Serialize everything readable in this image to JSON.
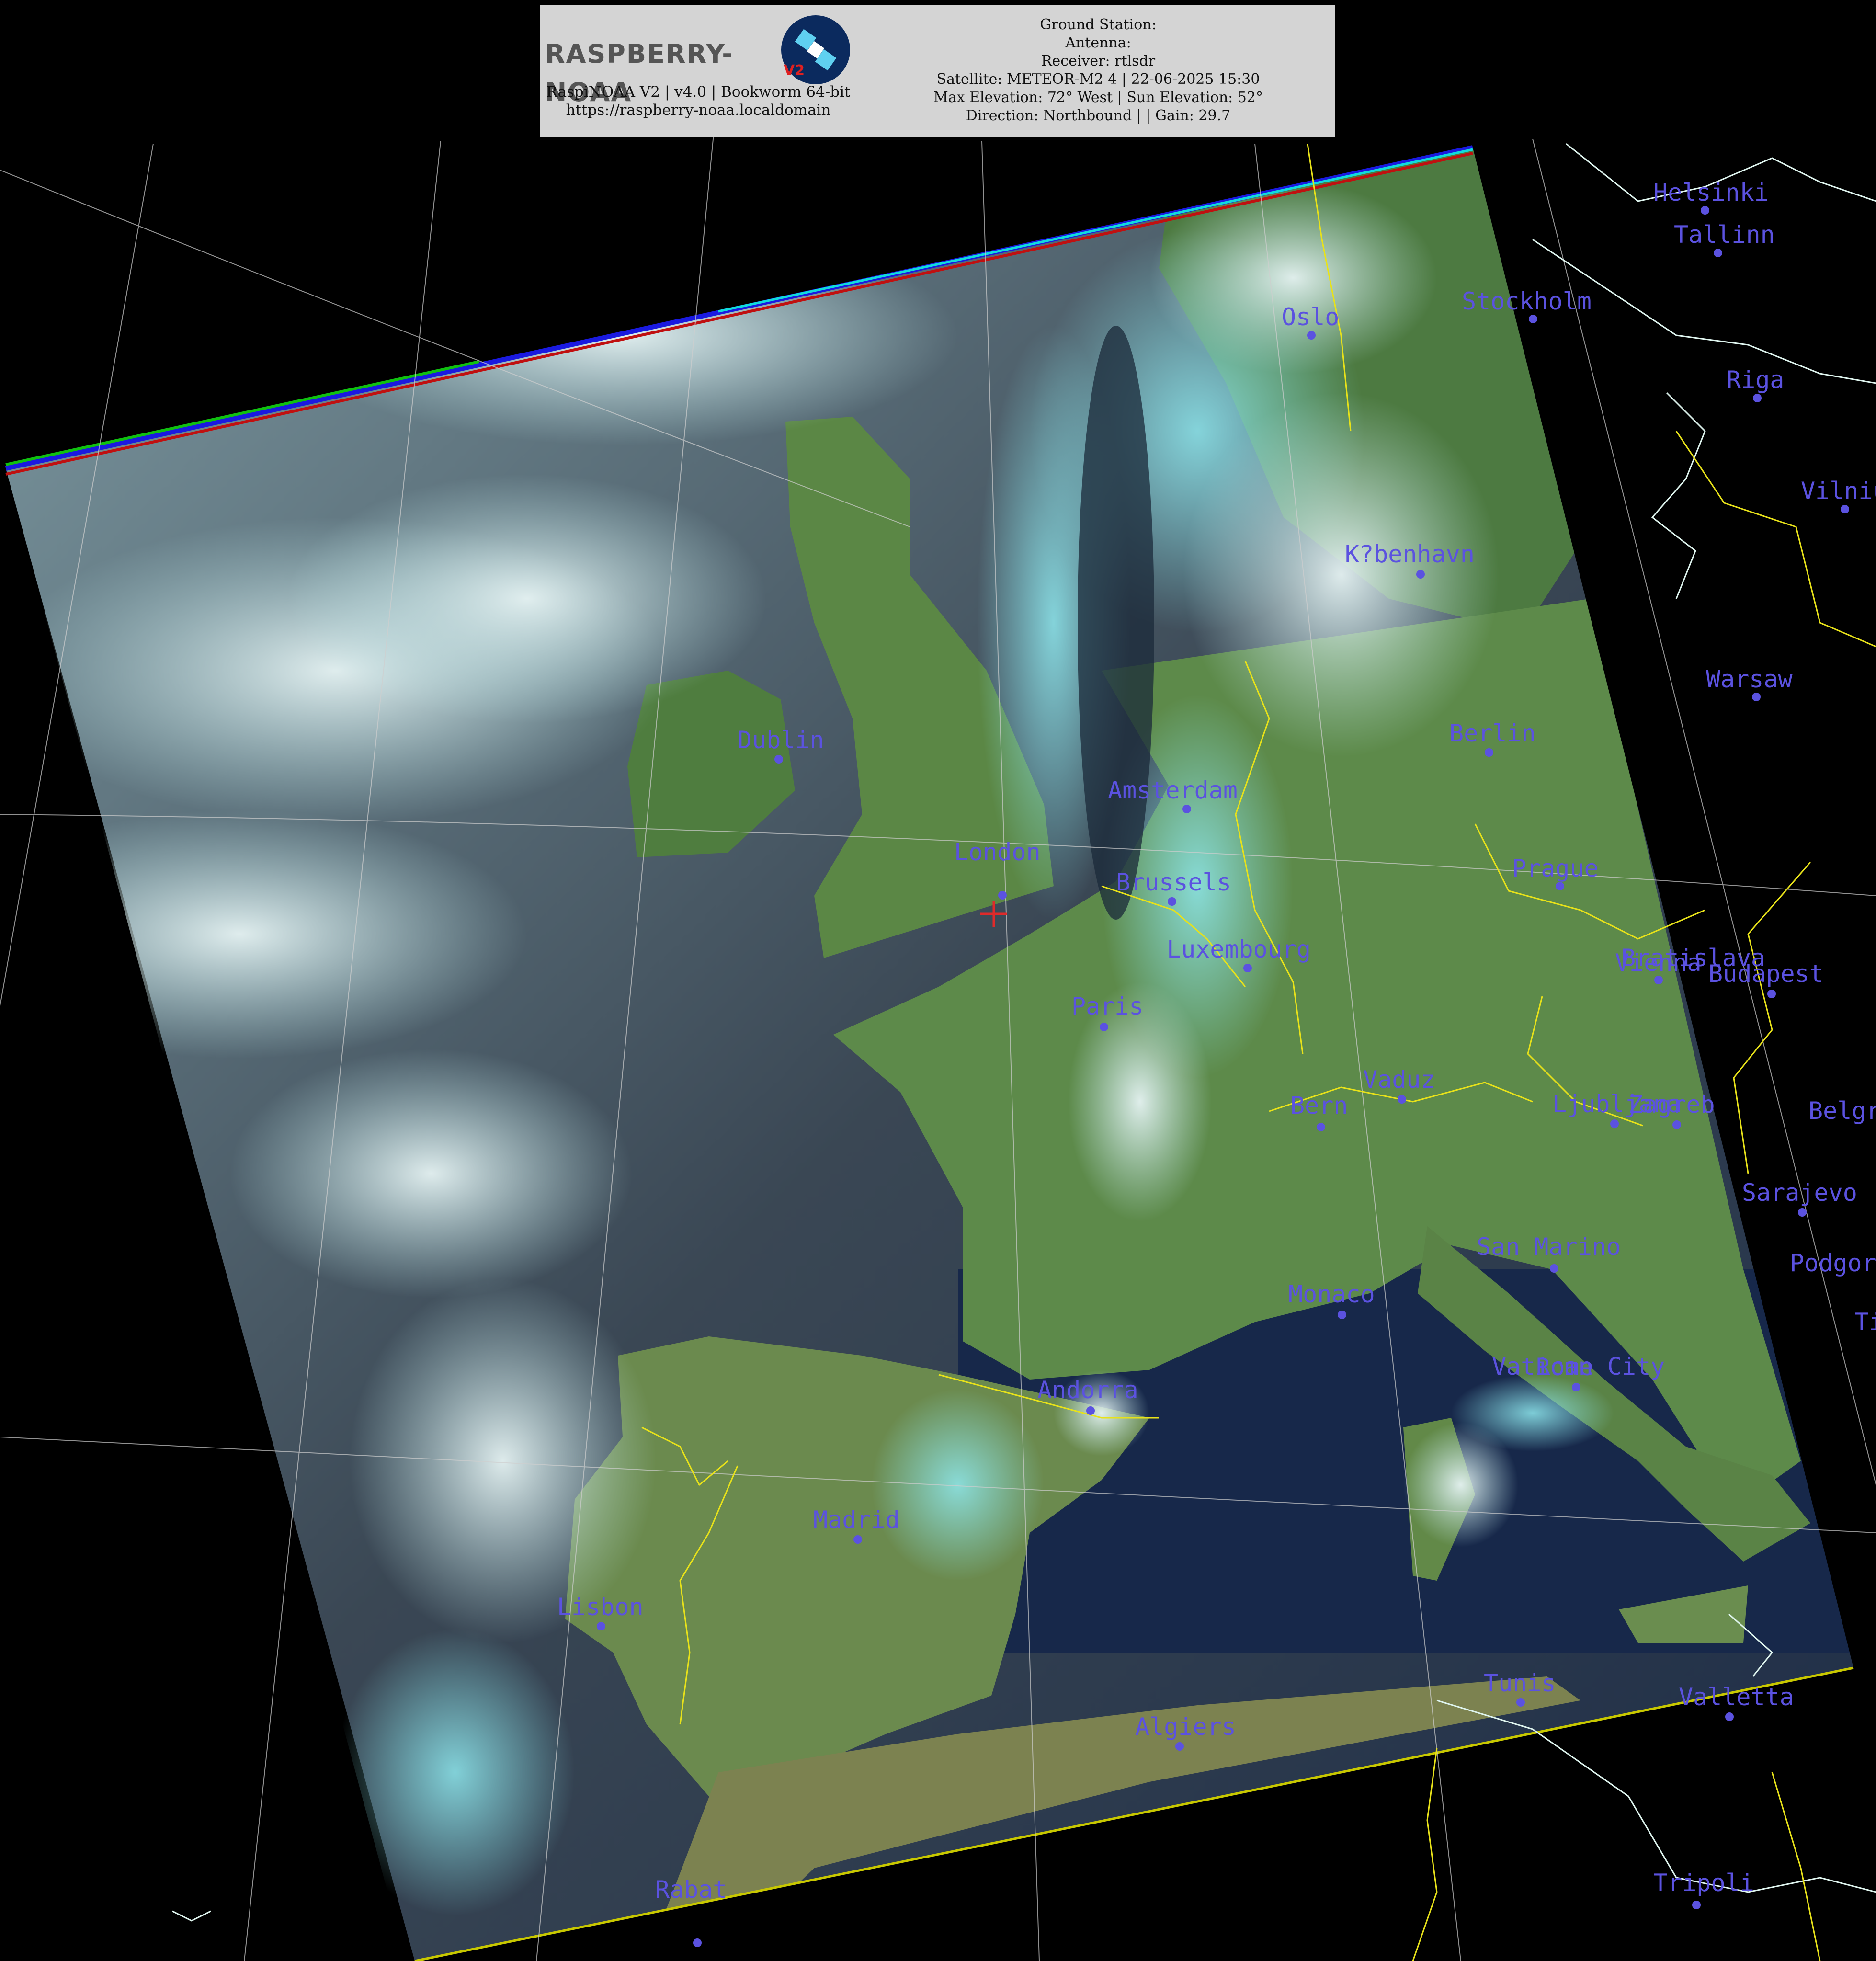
{
  "header": {
    "logo_text": "RASPBERRY-NOAA",
    "logo_badge": "V2",
    "software": "RaspiNOAA V2 | v4.0 | Bookworm 64-bit",
    "url": "https://raspberry-noaa.localdomain",
    "ground_station": "Ground Station:",
    "antenna": "Antenna:",
    "receiver": "Receiver: rtlsdr",
    "satellite_line": "Satellite: METEOR-M2 4 | 22-06-2025 15:30",
    "elevation_line": "Max Elevation: 72° West | Sun Elevation: 52°",
    "direction_line": "Direction: Northbound | | Gain: 29.7"
  },
  "colors": {
    "city_label": "#5b52e0",
    "graticule": "#cfcfcf",
    "border": "#e8e21a",
    "coast": "#dff5ef",
    "space": "#000000",
    "swath_edge": "#1a1ae0"
  },
  "cities": [
    {
      "name": "Helsinki"
    },
    {
      "name": "Tallinn"
    },
    {
      "name": "Stockholm"
    },
    {
      "name": "Oslo"
    },
    {
      "name": "Riga"
    },
    {
      "name": "Vilnius"
    },
    {
      "name": "K?benhavn"
    },
    {
      "name": "Warsaw"
    },
    {
      "name": "Berlin"
    },
    {
      "name": "Dublin"
    },
    {
      "name": "Amsterdam"
    },
    {
      "name": "London"
    },
    {
      "name": "Brussels"
    },
    {
      "name": "Prague"
    },
    {
      "name": "Luxembourg"
    },
    {
      "name": "Bratislava"
    },
    {
      "name": "Vienna"
    },
    {
      "name": "Budapest"
    },
    {
      "name": "Paris"
    },
    {
      "name": "Vaduz"
    },
    {
      "name": "Bern"
    },
    {
      "name": "Ljubljana"
    },
    {
      "name": "Zagreb"
    },
    {
      "name": "Belgrade"
    },
    {
      "name": "Sarajevo"
    },
    {
      "name": "San Marino"
    },
    {
      "name": "Podgorica"
    },
    {
      "name": "Tirana"
    },
    {
      "name": "Monaco"
    },
    {
      "name": "Vatican City"
    },
    {
      "name": "Rome"
    },
    {
      "name": "Andorra"
    },
    {
      "name": "Madrid"
    },
    {
      "name": "Lisbon"
    },
    {
      "name": "Tunis"
    },
    {
      "name": "Valletta"
    },
    {
      "name": "Algiers"
    },
    {
      "name": "Tripoli"
    },
    {
      "name": "Rabat"
    }
  ]
}
